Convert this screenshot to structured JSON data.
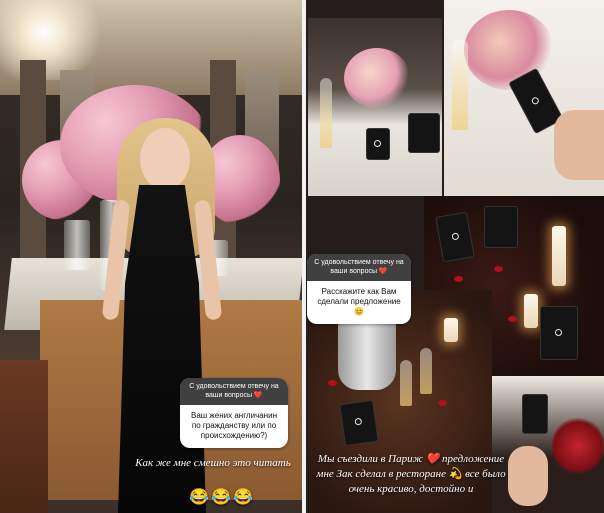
{
  "left_story": {
    "question_box": {
      "header": "С удовольствием отвечу на ваши вопросы ❤️",
      "question": "Ваш жених англичанин по гражданству или по происхождению?)"
    },
    "caption": "Как же мне смешно это читать",
    "emojis": "😂😂😂"
  },
  "right_story": {
    "question_box": {
      "header": "С удовольствием отвечу на ваши вопросы ❤️",
      "question": "Расскажите как Вам сделали предложение😊"
    },
    "caption": "Мы съездили в Париж ❤️ предложение мне Зак сделал в ресторане 💫 все было очень красиво, достойно и"
  },
  "colors": {
    "question_header_bg": "#404040",
    "question_body_bg": "#ffffff",
    "divider": "#f2f2f2",
    "rose_pink": "#e59fb5",
    "petal_red": "#b0101a"
  }
}
